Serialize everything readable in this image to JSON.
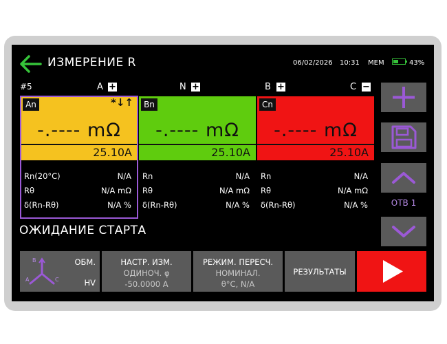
{
  "header": {
    "title": "ИЗМЕРЕНИЕ R",
    "date": "06/02/2026",
    "time": "10:31",
    "mem": "MEM",
    "battery": "43%",
    "battery_level": 0.43
  },
  "phase_row": {
    "number": "#5",
    "labels": [
      {
        "label": "A",
        "toggle": "+"
      },
      {
        "label": "N",
        "toggle": "+"
      },
      {
        "label": "B",
        "toggle": "+"
      },
      {
        "label": "C",
        "toggle": "−"
      }
    ]
  },
  "panels": [
    {
      "name": "An",
      "value": "-.---- mΩ",
      "current": "25.10A",
      "marker": "*↓↑",
      "color": "#f5c21f"
    },
    {
      "name": "Bn",
      "value": "-.---- mΩ",
      "current": "25.10A",
      "color": "#5fcc0e"
    },
    {
      "name": "Cn",
      "value": "-.---- mΩ",
      "current": "25.10A",
      "color": "#f01414"
    }
  ],
  "info": [
    {
      "rows": [
        {
          "label": "Rn(20°C)",
          "value": "N/A"
        },
        {
          "label": "Rθ",
          "value": "N/A mΩ"
        },
        {
          "label": "δ(Rn-Rθ)",
          "value": "N/A %"
        }
      ]
    },
    {
      "rows": [
        {
          "label": "Rn",
          "value": "N/A"
        },
        {
          "label": "Rθ",
          "value": "N/A mΩ"
        },
        {
          "label": "δ(Rn-Rθ)",
          "value": "N/A %"
        }
      ]
    },
    {
      "rows": [
        {
          "label": "Rn",
          "value": "N/A"
        },
        {
          "label": "Rθ",
          "value": "N/A mΩ"
        },
        {
          "label": "δ(Rn-Rθ)",
          "value": "N/A %"
        }
      ]
    }
  ],
  "status": "ОЖИДАНИЕ СТАРТА",
  "side": {
    "tap_label": "ОТВ 1"
  },
  "bottom": {
    "winding": {
      "title": "ОБМ.",
      "value": "HV",
      "diagram": {
        "b": "B",
        "a": "A",
        "c": "C"
      }
    },
    "settings": {
      "title": "НАСТР. ИЗМ.",
      "line1": "ОДИНОЧ. φ",
      "line2": "-50.0000 A"
    },
    "recalc": {
      "title": "РЕЖИМ. ПЕРЕСЧ.",
      "line1": "НОМИНАЛ.",
      "line2": "θ°C, N/A"
    },
    "results": "РЕЗУЛЬТАТЫ"
  },
  "colors": {
    "accent_purple": "#9b59d6",
    "back_arrow_green": "#36c43a",
    "play_red": "#f01414"
  }
}
